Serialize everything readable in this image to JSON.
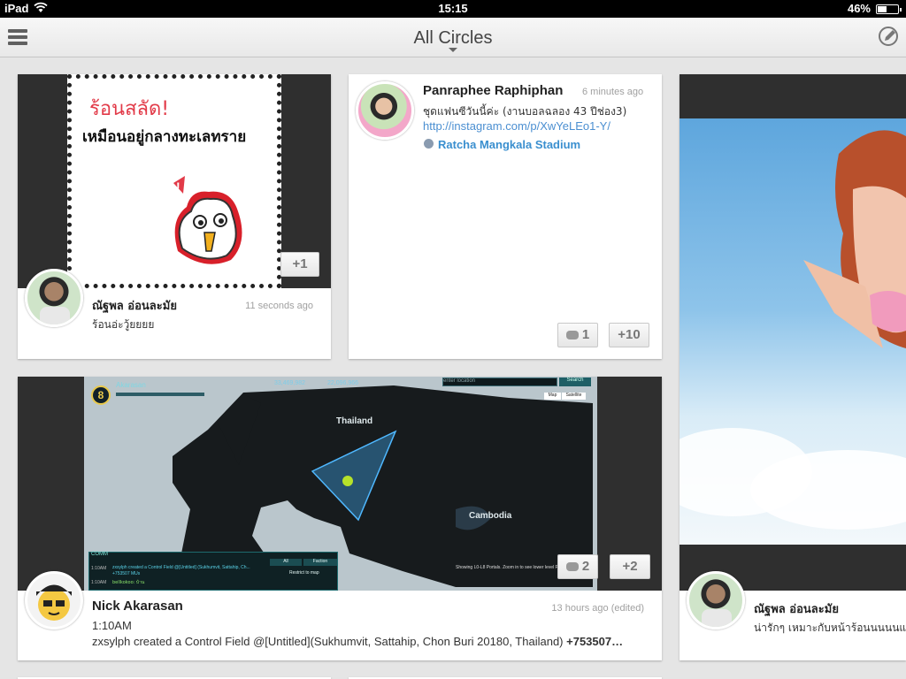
{
  "status_bar": {
    "device": "iPad",
    "time": "15:15",
    "battery": "46%",
    "battery_level": 0.46
  },
  "nav": {
    "title": "All Circles",
    "menu_icon": "hamburger-menu-icon",
    "compose_icon": "compose-pencil-icon"
  },
  "posts": [
    {
      "image_caption_line1": "ร้อนสลัด!",
      "image_caption_line2": "เหมือนอยู่กลางทะเลทราย",
      "plus_count": "+1",
      "author": "ณัฐพล อ่อนละมัย",
      "time": "11 seconds ago",
      "text": "ร้อนอ่ะวู้ยยยย"
    },
    {
      "author": "Panraphee Raphiphan",
      "time": "6 minutes ago",
      "text": "ชุดแฟนซีวันนี้ค่ะ (งานบอลฉลอง 43 ปีช่อง3)",
      "link": "http://instagram.com/p/XwYeLEo1-Y/",
      "location": "Ratcha Mangkala Stadium",
      "comment_count": "1",
      "plus_count": "+10"
    },
    {
      "author": "Nick Akarasan",
      "time": "13 hours ago (edited)",
      "line1": "1:10AM",
      "line2_text": "zxsylph created a Control Field @[Untitled](Sukhumvit, Sattahip, Chon Buri 20180, Thailand) ",
      "line2_bold": "+753507…",
      "comment_count": "2",
      "plus_count": "+2",
      "map": {
        "agent_name": "Akarasan",
        "level": "8",
        "score_left": "33,469,982",
        "score_right": "22,096,966",
        "search_placeholder": "enter location",
        "search_button": "Search",
        "map_button": "Map",
        "satellite_button": "Satellite",
        "country_label": "Thailand",
        "country_label_2": "Cambodia",
        "comm_title": "COMM",
        "comm_tab_all": "All",
        "comm_tab_faction": "Faction",
        "comm_restrict": "Restrict to map",
        "comm_line1": "zxsylph created a Control Field @[Untitled] (Sukhumvit, Sattahip, Ch...",
        "comm_line2": "+753507 MUs",
        "comm_line3": "bellkokoo: บ้าน",
        "comm_time1": "1:10AM",
        "comm_time2": "1:10AM",
        "footer_text": "Showing L0-L8 Portals. Zoom in to see lower level Portals."
      }
    },
    {
      "author": "ณัฐพล อ่อนละมัย",
      "text": "น่ารักๆ เหมาะกับหน้าร้อนนนนนแบบ"
    }
  ]
}
